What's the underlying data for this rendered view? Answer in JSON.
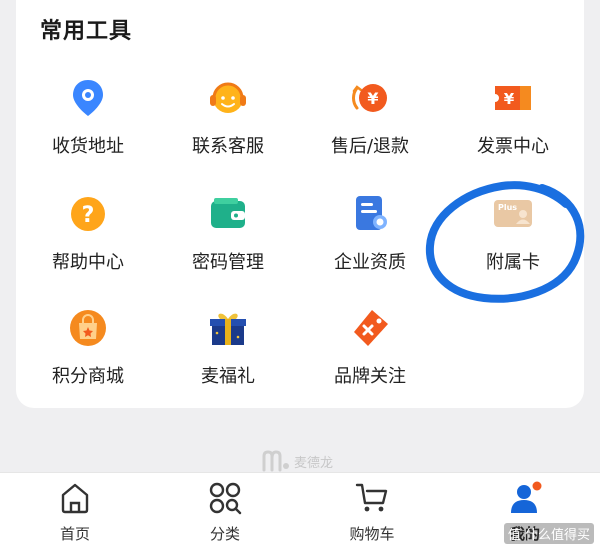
{
  "section": {
    "title": "常用工具"
  },
  "tools": [
    {
      "label": "收货地址"
    },
    {
      "label": "联系客服"
    },
    {
      "label": "售后/退款"
    },
    {
      "label": "发票中心"
    },
    {
      "label": "帮助中心"
    },
    {
      "label": "密码管理"
    },
    {
      "label": "企业资质"
    },
    {
      "label": "附属卡",
      "card_text": "Plus"
    },
    {
      "label": "积分商城"
    },
    {
      "label": "麦福礼"
    },
    {
      "label": "品牌关注"
    }
  ],
  "watermark": {
    "text": "麦德龙"
  },
  "tabbar": {
    "items": [
      {
        "label": "首页"
      },
      {
        "label": "分类"
      },
      {
        "label": "购物车"
      },
      {
        "label": "我的"
      }
    ],
    "active_index": 3
  },
  "corner_watermark": "值 什么值得买",
  "colors": {
    "accent_blue": "#1565d8",
    "orange": "#f58a1f",
    "red_orange": "#f25a1e",
    "green": "#1fb08a",
    "annotation_blue": "#1a6fe0"
  }
}
